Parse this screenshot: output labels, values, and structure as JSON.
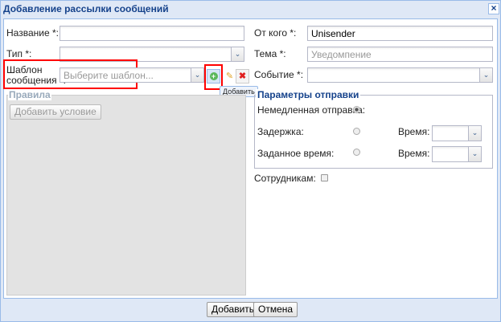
{
  "window": {
    "title": "Добавление рассылки сообщений",
    "close_icon": "close-icon"
  },
  "left": {
    "name_label": "Название *:",
    "name_value": "",
    "type_label": "Тип *:",
    "type_value": "",
    "template_label_1": "Шаблон",
    "template_label_2": "сообщения *:",
    "template_placeholder": "Выберите шаблон...",
    "add_tooltip": "Добавить",
    "rules_legend": "Правила",
    "add_condition": "Добавить условие"
  },
  "right": {
    "from_label": "От кого *:",
    "from_value": "Unisender",
    "subject_label": "Тема *:",
    "subject_placeholder": "Уведомпение",
    "event_label": "Событие *:",
    "event_value": "",
    "send_legend": "Параметры отправки",
    "immediate_label": "Немедленная отправка:",
    "delay_label": "Задержка:",
    "time_label_1": "Время:",
    "scheduled_label": "Заданное время:",
    "time_label_2": "Время:",
    "staff_label": "Сотрудникам:",
    "send_mode": "immediate",
    "staff_checked": false
  },
  "footer": {
    "add": "Добавить",
    "cancel": "Отмена"
  },
  "colors": {
    "title": "#15428b",
    "highlight": "#ff0000",
    "frame": "#99bbe8"
  }
}
